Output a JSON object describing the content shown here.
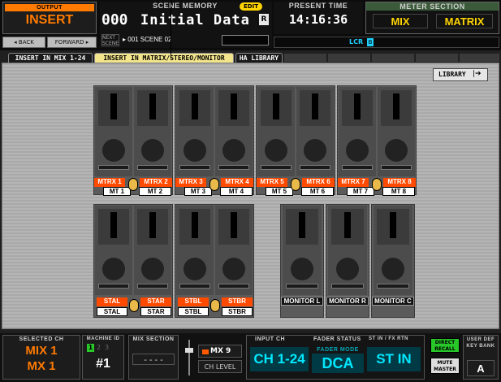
{
  "header": {
    "output_label": "OUTPUT",
    "output_value": "INSERT",
    "back_label": "◂ BACK",
    "forward_label": "FORWARD ▸",
    "scene_memory_label": "SCENE MEMORY",
    "edit_badge": "EDIT",
    "scene_number": "000",
    "scene_name": "Initial Data",
    "scene_r": "R",
    "next_scene_label": "NEXT SCENE",
    "next_scene_value": "▸ 001 SCENE 02",
    "present_time_label": "PRESENT TIME",
    "present_time_value": "14:16:36",
    "lcr_label": "LCR",
    "lcr_badge": "B",
    "meter_section_label": "METER SECTION",
    "meter_mix": "MIX",
    "meter_matrix": "MATRIX"
  },
  "tabs": [
    {
      "label": "INSERT IN MIX 1-24",
      "active": false
    },
    {
      "label": "INSERT IN MATRIX/STEREO/MONITOR",
      "active": true
    },
    {
      "label": "HA LIBRARY",
      "active": false
    }
  ],
  "main": {
    "library_button": "LIBRARY",
    "library_icon": "arrow-right-icon",
    "matrix_channels": [
      {
        "top": "MTRX 1",
        "bottom": "MT 1"
      },
      {
        "top": "MTRX 2",
        "bottom": "MT 2"
      },
      {
        "top": "MTRX 3",
        "bottom": "MT 3"
      },
      {
        "top": "MTRX 4",
        "bottom": "MT 4"
      },
      {
        "top": "MTRX 5",
        "bottom": "MT 5"
      },
      {
        "top": "MTRX 6",
        "bottom": "MT 6"
      },
      {
        "top": "MTRX 7",
        "bottom": "MT 7"
      },
      {
        "top": "MTRX 8",
        "bottom": "MT 8"
      }
    ],
    "stereo_channels": [
      {
        "top": "STAL",
        "bottom": "STAL"
      },
      {
        "top": "STAR",
        "bottom": "STAR"
      },
      {
        "top": "STBL",
        "bottom": "STBL"
      },
      {
        "top": "STBR",
        "bottom": "STBR"
      }
    ],
    "monitor_channels": [
      "MONITOR L",
      "MONITOR R",
      "MONITOR C"
    ]
  },
  "footer": {
    "selected_ch_label": "SELECTED CH",
    "selected_ch_line1": "MIX 1",
    "selected_ch_line2": "MX 1",
    "machine_id_label": "MACHINE ID",
    "machine_id_digits": [
      "1",
      "2",
      "3"
    ],
    "machine_id_value": "#1",
    "mix_section_label": "MIX SECTION",
    "mix_section_value": "----",
    "mix9_label": "MX 9",
    "ch_level_label": "CH LEVEL",
    "input_ch_label": "INPUT CH",
    "input_ch_value": "CH 1-24",
    "fader_status_label": "FADER STATUS",
    "fader_mode_label": "FADER MODE",
    "fader_mode_value": "DCA",
    "st_in_label": "ST IN / FX RTN",
    "st_in_value": "ST IN",
    "direct_recall_label": "DIRECT RECALL",
    "mute_master_label": "MUTE MASTER",
    "user_def_label": "USER DEF KEY BANK",
    "user_def_value": "A"
  },
  "colors": {
    "accent_orange": "#ff4a00",
    "active_tab": "#f3e58c",
    "cyan_value": "#00e8ff",
    "meter_yellow": "#ffd400"
  }
}
